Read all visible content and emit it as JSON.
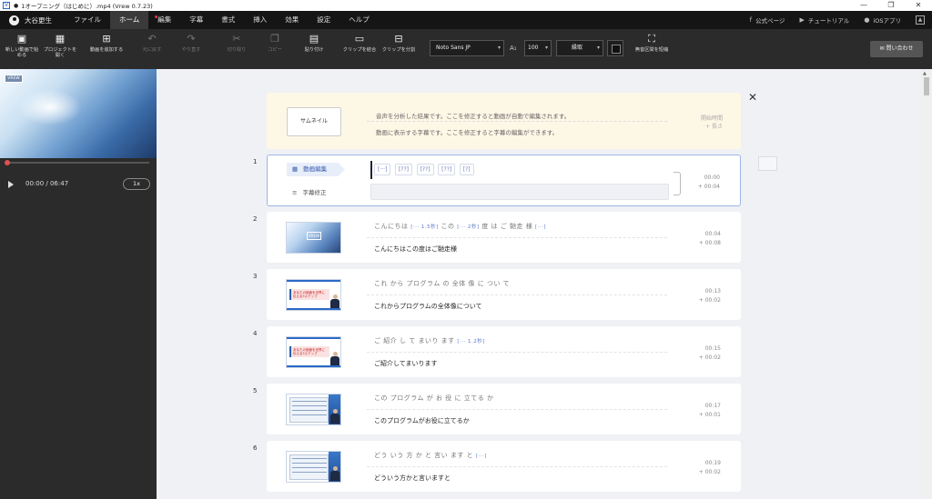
{
  "window": {
    "title": "1オープニング（はじめに）.mp4 (Vrew 0.7.23)",
    "controls": [
      "—",
      "❐",
      "✕"
    ]
  },
  "menubar": {
    "user": "大谷更生",
    "items": [
      "ファイル",
      "ホーム",
      "編集",
      "字幕",
      "書式",
      "挿入",
      "効果",
      "設定",
      "ヘルプ"
    ],
    "right_links": [
      {
        "icon": "facebook-icon",
        "label": "公式ページ"
      },
      {
        "icon": "youtube-icon",
        "label": "チュートリアル"
      },
      {
        "icon": "apple-icon",
        "label": "iOSアプリ"
      }
    ]
  },
  "toolbar": {
    "buttons": [
      {
        "label": "新しい動画で始める"
      },
      {
        "label": "プロジェクトを開く"
      },
      {
        "label": "動画を追加する"
      },
      {
        "label": "元に戻す"
      },
      {
        "label": "やり直す"
      },
      {
        "label": "切り取り"
      },
      {
        "label": "コピー"
      },
      {
        "label": "貼り付け"
      },
      {
        "label": "クリップを結合"
      },
      {
        "label": "クリップを分割"
      },
      {
        "label": "無音区間を短縮"
      }
    ],
    "font": "Noto Sans JP",
    "size": "100",
    "wrap": "縁取",
    "contact": "問い合わせ"
  },
  "player": {
    "logo": "VREW",
    "time": "00:00 / 06:47",
    "speed": "1x"
  },
  "header": {
    "thumbnail_label": "サムネイル",
    "line1": "音声を分析した結果です。ここを修正すると動画が自動で編集されます。",
    "line2": "動画に表示する字幕です。ここを修正すると字幕の編集ができます。",
    "time_label": "開始時間",
    "duration_label": "+ 長さ"
  },
  "selected_row": {
    "num": "1",
    "tab_video": "動画編集",
    "tab_caption": "字幕修正",
    "chips": [
      "[···]",
      "[??]",
      "[??]",
      "[??]",
      "[?]"
    ],
    "start": "00:00",
    "dur": "+ 00:04"
  },
  "rows": [
    {
      "num": "2",
      "sub": [
        "こんにちは",
        "[··· 1.5秒]",
        "この",
        "[··· 2秒]",
        "度",
        "は",
        "ご",
        "馳走",
        "様",
        "[···]"
      ],
      "main": "こんにちはこの度はご馳走様",
      "start": "00:04",
      "dur": "+ 00:08"
    },
    {
      "num": "3",
      "sub": [
        "これ",
        "から",
        "プログラム",
        "の",
        "全体",
        "像",
        "に",
        "つい",
        "て"
      ],
      "main": "これからプログラムの全体像について",
      "start": "00:13",
      "dur": "+ 00:02",
      "slide": "あなたの価値を世界に伝える3ステップ"
    },
    {
      "num": "4",
      "sub": [
        "ご",
        "紹介",
        "し",
        "て",
        "まいり",
        "ます",
        "[··· 1.2秒]"
      ],
      "main": "ご紹介してまいります",
      "start": "00:15",
      "dur": "+ 00:02",
      "slide": "あなたの価値を世界に伝える3ステップ"
    },
    {
      "num": "5",
      "sub": [
        "この",
        "プログラム",
        "が",
        "お",
        "役",
        "に",
        "立てる",
        "か"
      ],
      "main": "このプログラムがお役に立てるか",
      "start": "00:17",
      "dur": "+ 00:01"
    },
    {
      "num": "6",
      "sub": [
        "どう",
        "いう",
        "方",
        "か",
        "と",
        "言い",
        "ます",
        "と",
        "[···]"
      ],
      "main": "どういう方かと言いますと",
      "start": "00:19",
      "dur": "+ 00:02"
    }
  ]
}
